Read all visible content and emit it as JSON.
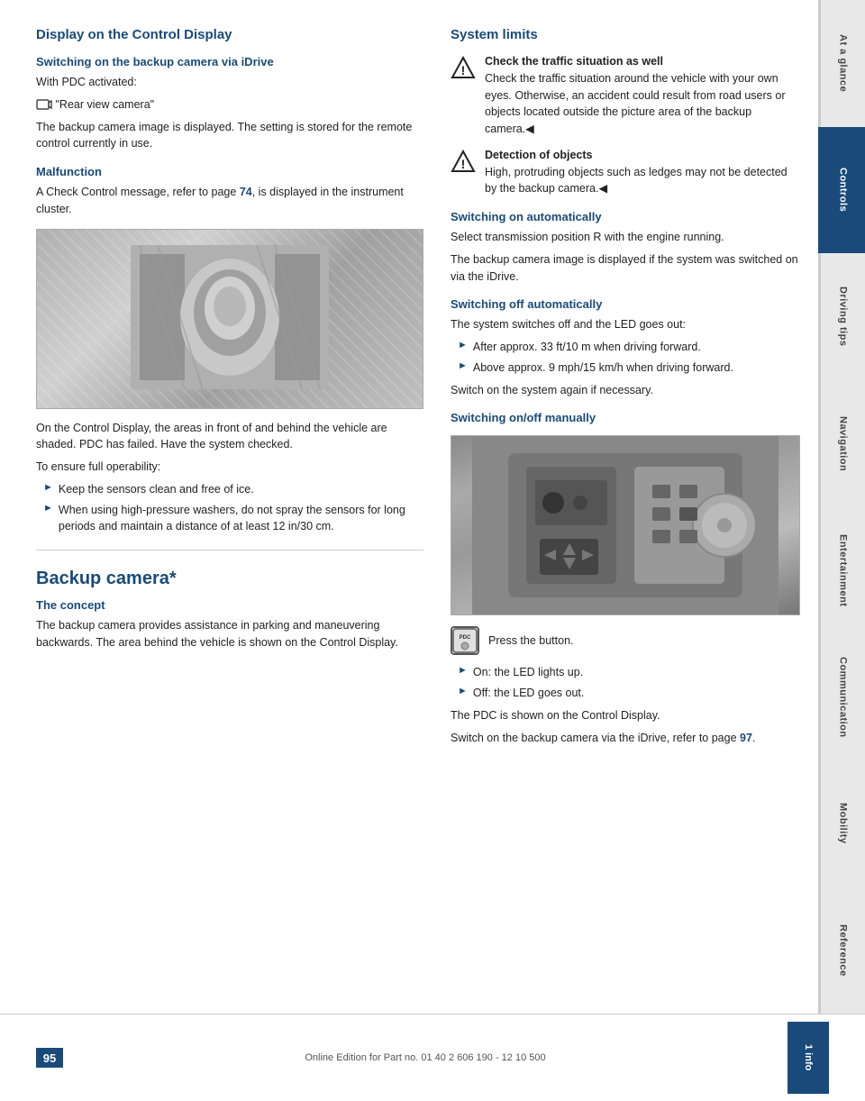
{
  "sidebar": {
    "items": [
      {
        "label": "At a glance",
        "active": false
      },
      {
        "label": "Controls",
        "active": true
      },
      {
        "label": "Driving tips",
        "active": false
      },
      {
        "label": "Navigation",
        "active": false
      },
      {
        "label": "Entertainment",
        "active": false
      },
      {
        "label": "Communication",
        "active": false
      },
      {
        "label": "Mobility",
        "active": false
      },
      {
        "label": "Reference",
        "active": false
      }
    ]
  },
  "left_col": {
    "main_heading": "Display on the Control Display",
    "switching_on_heading": "Switching on the backup camera via iDrive",
    "with_pdc": "With PDC activated:",
    "rear_view_label": "\"Rear view camera\"",
    "backup_camera_text": "The backup camera image is displayed. The setting is stored for the remote control currently in use.",
    "malfunction_heading": "Malfunction",
    "malfunction_text1": "A Check Control message, refer to page ",
    "malfunction_link": "74",
    "malfunction_text2": ", is displayed in the instrument cluster.",
    "image_caption": "On the Control Display, the areas in front of and behind the vehicle are shaded. PDC has failed. Have the system checked.",
    "operability_heading": "To ensure full operability:",
    "bullet1": "Keep the sensors clean and free of ice.",
    "bullet2": "When using high-pressure washers, do not spray the sensors for long periods and maintain a distance of at least 12 in/30 cm.",
    "backup_camera_heading": "Backup camera*",
    "concept_heading": "The concept",
    "concept_text": "The backup camera provides assistance in parking and maneuvering backwards. The area behind the vehicle is shown on the Control Display."
  },
  "right_col": {
    "system_limits_heading": "System limits",
    "warning1_text": "Check the traffic situation as well\nCheck the traffic situation around the vehicle with your own eyes. Otherwise, an accident could result from road users or objects located outside the picture area of the backup camera.",
    "warning2_text": "Detection of objects\nHigh, protruding objects such as ledges may not be detected by the backup camera.",
    "switching_on_auto_heading": "Switching on automatically",
    "switching_on_auto_text1": "Select transmission position R with the engine running.",
    "switching_on_auto_text2": "The backup camera image is displayed if the system was switched on via the iDrive.",
    "switching_off_auto_heading": "Switching off automatically",
    "switching_off_auto_text": "The system switches off and the LED goes out:",
    "bullet_after": "After approx. 33 ft/10 m when driving forward.",
    "bullet_above": "Above approx. 9 mph/15 km/h when driving forward.",
    "switch_again": "Switch on the system again if necessary.",
    "switching_manual_heading": "Switching on/off manually",
    "press_button": "Press the button.",
    "bullet_on": "On: the LED lights up.",
    "bullet_off": "Off: the LED goes out.",
    "pdc_shown": "The PDC is shown on the Control Display.",
    "switch_backup_text1": "Switch on the backup camera via the iDrive, refer to page ",
    "switch_backup_link": "97",
    "switch_backup_text2": "."
  },
  "footer": {
    "page_number": "95",
    "footer_text": "Online Edition for Part no. 01 40 2 606 190 - 12 10 500",
    "info_badge": "1 info"
  }
}
